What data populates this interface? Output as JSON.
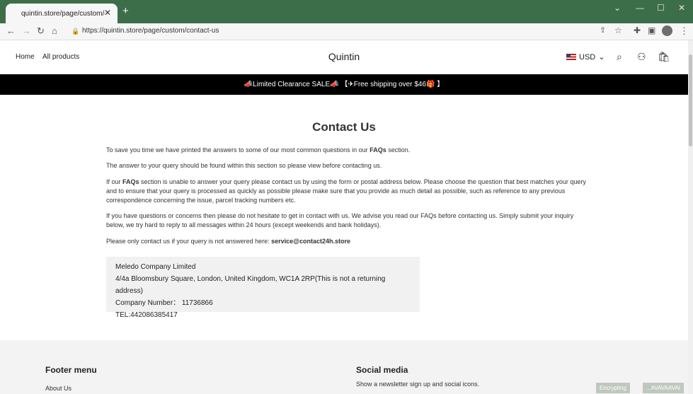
{
  "browser": {
    "tab_title": "quintin.store/page/custom/conta",
    "url": "https://quintin.store/page/custom/contact-us"
  },
  "header": {
    "nav": [
      "Home",
      "All products"
    ],
    "brand": "Quintin",
    "currency": "USD"
  },
  "announcement": "📣Limited Clearance SALE📣  【✈Free shipping over $46🎁 】",
  "main": {
    "title": "Contact Us",
    "p1_pre": "To save you time we have printed the answers to some of our most common questions in our ",
    "p1_bold": "FAQs",
    "p1_post": " section.",
    "p2": "The answer to your query should be found within this section so please view before contacting us.",
    "p3_pre": "If our ",
    "p3_bold": "FAQs",
    "p3_post": " section is unable to answer your query please contact us by using the form or postal address below. Please choose the question that best matches your query and to ensure that your query is processed as quickly as possible please make sure that you provide as much detail as possible, such as reference to any previous correspondence concerning the issue, parcel tracking numbers etc.",
    "p4": "If you have questions or concerns then please do not hesitate to get in contact with us. We advise you read our FAQs before contacting us. Simply submit your inquiry below, we try hard to reply to all messages within 24 hours (except weekends and bank holidays).",
    "p5_pre": "Please only contact us if your query is not answered here: ",
    "p5_email": "service@contact24h.store",
    "address": [
      "Meledo Company Limited",
      "4/4a Bloomsbury Square, London, United Kingdom, WC1A 2RP(This is not a returning address)",
      "Company Number： 11736866",
      "TEL:442086385417"
    ]
  },
  "footer": {
    "menu_title": "Footer menu",
    "menu_items": [
      "About Us"
    ],
    "social_title": "Social media",
    "social_text": "Show a newsletter sign up and social icons."
  },
  "status": {
    "left": "Encrypting",
    "right": "...AVAVAAVAI"
  }
}
